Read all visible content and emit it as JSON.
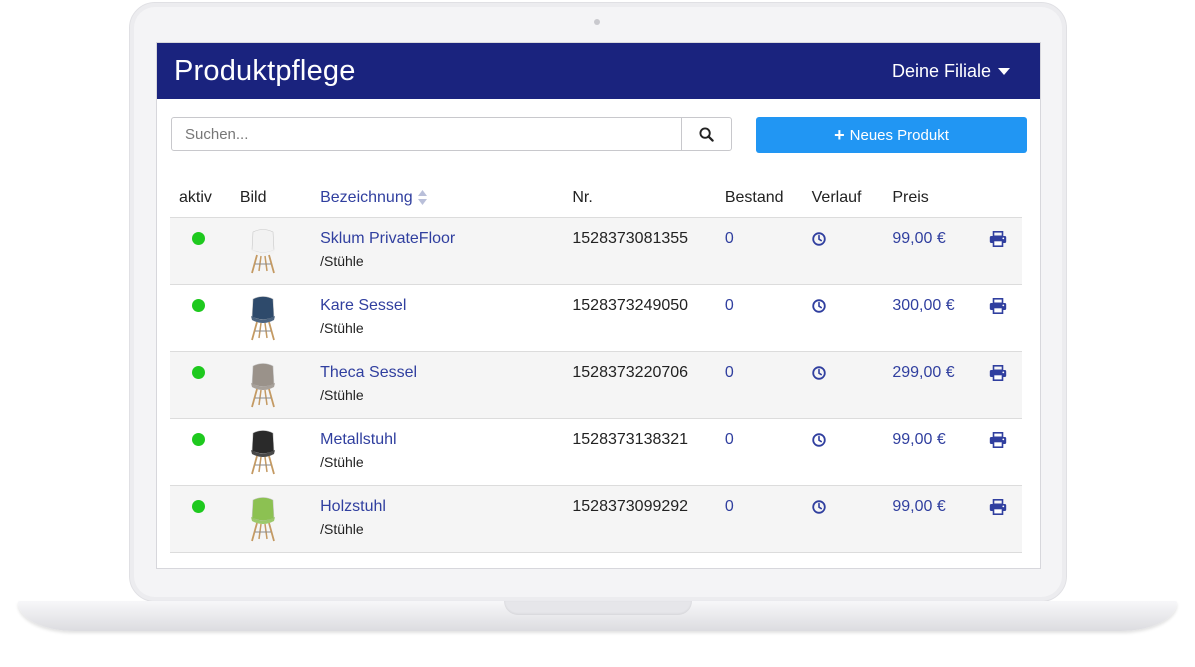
{
  "header": {
    "title": "Produktpflege",
    "branch_label": "Deine Filiale"
  },
  "toolbar": {
    "search_placeholder": "Suchen...",
    "new_product_label": "Neues Produkt"
  },
  "table": {
    "columns": {
      "aktiv": "aktiv",
      "bild": "Bild",
      "bezeichnung": "Bezeichnung",
      "nr": "Nr.",
      "bestand": "Bestand",
      "verlauf": "Verlauf",
      "preis": "Preis"
    },
    "rows": [
      {
        "name": "Sklum PrivateFloor",
        "category": "/Stühle",
        "nr": "1528373081355",
        "stock": "0",
        "price": "99,00 €",
        "active": true,
        "chair_color": "#f2f2f2"
      },
      {
        "name": "Kare Sessel",
        "category": "/Stühle",
        "nr": "1528373249050",
        "stock": "0",
        "price": "300,00 €",
        "active": true,
        "chair_color": "#2e4a6b"
      },
      {
        "name": "Theca Sessel",
        "category": "/Stühle",
        "nr": "1528373220706",
        "stock": "0",
        "price": "299,00 €",
        "active": true,
        "chair_color": "#9a928a"
      },
      {
        "name": "Metallstuhl",
        "category": "/Stühle",
        "nr": "1528373138321",
        "stock": "0",
        "price": "99,00 €",
        "active": true,
        "chair_color": "#2a2a2a"
      },
      {
        "name": "Holzstuhl",
        "category": "/Stühle",
        "nr": "1528373099292",
        "stock": "0",
        "price": "99,00 €",
        "active": true,
        "chair_color": "#8cc152"
      }
    ]
  },
  "colors": {
    "header_bg": "#1a237e",
    "primary_button": "#2196f3",
    "link": "#303f9f",
    "active_dot": "#1ec91e"
  }
}
